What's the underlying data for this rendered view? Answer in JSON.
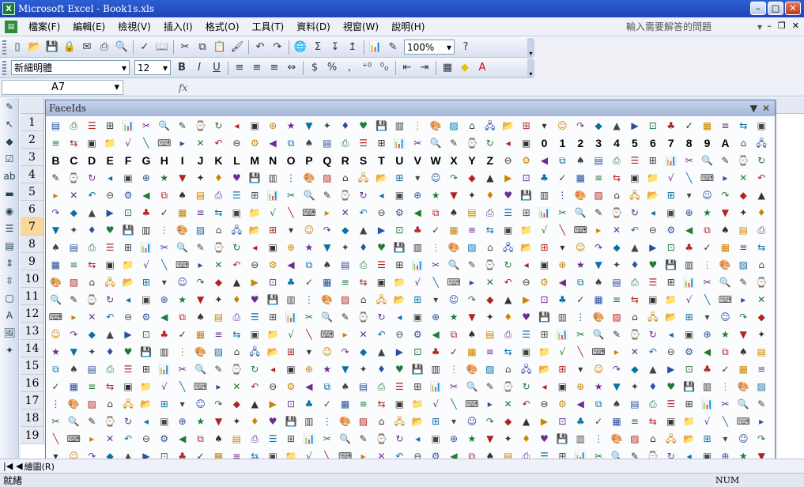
{
  "window": {
    "title": "Microsoft Excel - Book1s.xls",
    "min_label": "–",
    "max_label": "□",
    "close_label": "✕"
  },
  "menubar": {
    "items": [
      {
        "label": "檔案(F)",
        "name": "menu-file"
      },
      {
        "label": "編輯(E)",
        "name": "menu-edit"
      },
      {
        "label": "檢視(V)",
        "name": "menu-view"
      },
      {
        "label": "插入(I)",
        "name": "menu-insert"
      },
      {
        "label": "格式(O)",
        "name": "menu-format"
      },
      {
        "label": "工具(T)",
        "name": "menu-tools"
      },
      {
        "label": "資料(D)",
        "name": "menu-data"
      },
      {
        "label": "視窗(W)",
        "name": "menu-window"
      },
      {
        "label": "說明(H)",
        "name": "menu-help"
      }
    ],
    "help_placeholder": "輸入需要解答的問題"
  },
  "toolbar": {
    "zoom": "100%",
    "font_name": "新細明體",
    "font_size": "12"
  },
  "formula_bar": {
    "name_box": "A7",
    "fx": "fx"
  },
  "row_headers": [
    "1",
    "2",
    "3",
    "4",
    "5",
    "6",
    "7",
    "8",
    "9",
    "10",
    "11",
    "12",
    "13",
    "14",
    "15",
    "16",
    "17",
    "18",
    "19"
  ],
  "selected_row": "7",
  "palette": {
    "title": "FaceIds",
    "rows": [
      "0000000000000000000000000000000000000000",
      "0000000000000000000000000000000000000000",
      "0000000000000000000000000000000000000000",
      "0000000000000000000000000000000000000000",
      "0000000000000000000000000000000000000000",
      "0000000000000000000000000000000000000000",
      "0000000000000000000000000000000000000000",
      "0000000000000000000000000000000000000000",
      "0000000000000000000000000000000000000000",
      "0000000000000000000000000000000000000000",
      "0000000000000000000000000000000000000000",
      "0000000000000000000000000000000000000000",
      "0000000000000000000000000000000000000000",
      "0000000000000000000000000000000000000000",
      "0000000000000000000000000000000000000000",
      "0000000000000000000000000000000000000000",
      "0000000000000000000000000000000000000000",
      "0000000000000000000000000000000000000000",
      "0000000000000000000000000000000000000000",
      "0000000000000000000000000000000000000000"
    ],
    "glyph_rows": {
      "1": [
        "",
        "",
        "",
        "",
        "",
        "",
        "",
        "",
        "",
        "",
        "",
        "",
        "",
        "",
        "",
        "",
        "",
        "",
        "",
        "",
        "",
        "",
        "",
        "",
        "",
        "",
        "",
        "0",
        "1",
        "2",
        "3",
        "4",
        "5",
        "6",
        "7",
        "8",
        "9",
        "A"
      ],
      "2": [
        "B",
        "C",
        "D",
        "E",
        "F",
        "G",
        "H",
        "I",
        "J",
        "K",
        "L",
        "M",
        "N",
        "O",
        "P",
        "Q",
        "R",
        "S",
        "T",
        "U",
        "V",
        "W",
        "X",
        "Y",
        "Z"
      ]
    }
  },
  "sheet_tabs_label": "繪圖(R)",
  "status": {
    "left": "就緒",
    "num": "NUM"
  }
}
